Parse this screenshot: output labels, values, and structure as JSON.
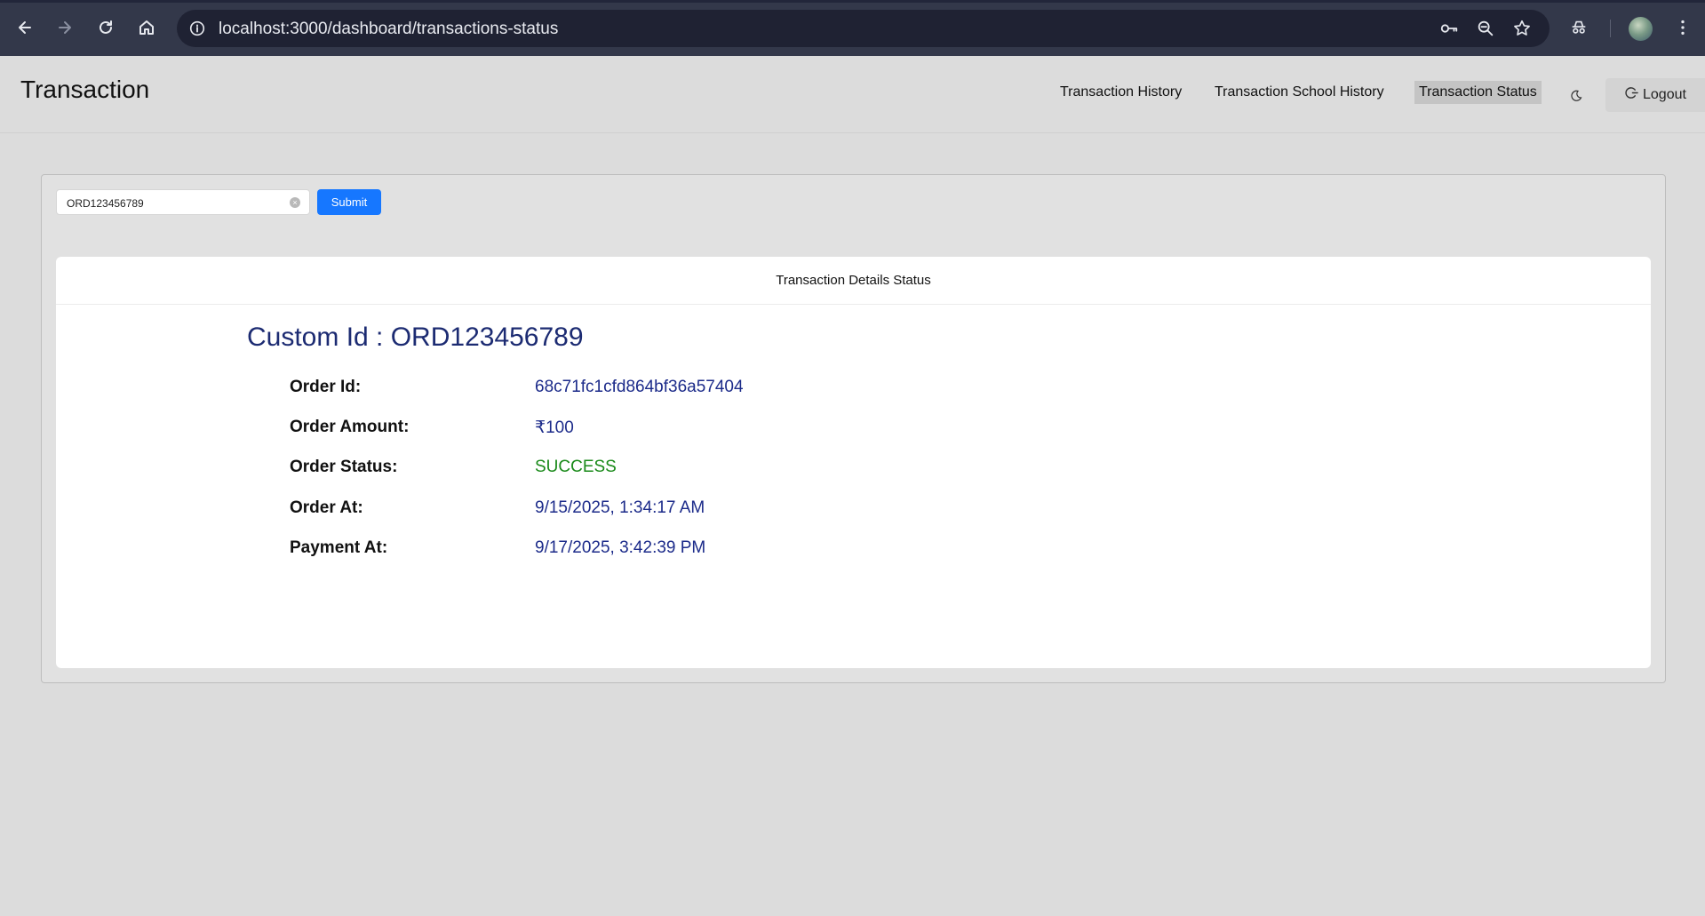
{
  "browser": {
    "url": "localhost:3000/dashboard/transactions-status"
  },
  "header": {
    "title": "Transaction",
    "nav": [
      {
        "label": "Transaction History"
      },
      {
        "label": "Transaction School History"
      },
      {
        "label": "Transaction Status",
        "active": true
      }
    ],
    "logout_label": "Logout"
  },
  "search": {
    "value": "ORD123456789",
    "submit_label": "Submit"
  },
  "details": {
    "heading": "Transaction Details Status",
    "custom_id": "Custom Id : ORD123456789",
    "rows": [
      {
        "label": "Order Id:",
        "value": "68c71fc1cfd864bf36a57404"
      },
      {
        "label": "Order Amount:",
        "value": "₹100"
      },
      {
        "label": "Order Status:",
        "value": "SUCCESS",
        "status_color": "#1a8a1a"
      },
      {
        "label": "Order At:",
        "value": "9/15/2025, 1:34:17 AM"
      },
      {
        "label": "Payment At:",
        "value": "9/17/2025, 3:42:39 PM"
      }
    ]
  },
  "colors": {
    "accent": "#1677ff",
    "value_text": "#1c2b8a",
    "success": "#1a8a1a"
  }
}
